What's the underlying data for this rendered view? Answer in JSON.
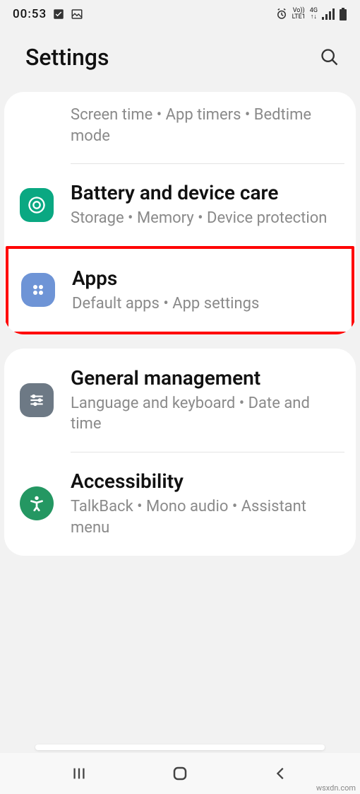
{
  "status": {
    "time": "00:53",
    "vo": "Vo))",
    "lte": "LTE1",
    "net": "4G"
  },
  "header": {
    "title": "Settings"
  },
  "groups": [
    {
      "items": [
        {
          "id": "digital-wellbeing",
          "title": "",
          "sub": "Screen time  •  App timers  •  Bedtime mode",
          "icon": null
        },
        {
          "id": "battery-device-care",
          "title": "Battery and device care",
          "sub": "Storage  •  Memory  •  Device protection",
          "icon": "care",
          "iconColor": "#0aa882"
        },
        {
          "id": "apps",
          "title": "Apps",
          "sub": "Default apps  •  App settings",
          "icon": "apps",
          "iconColor": "#6e94d6",
          "highlight": true
        }
      ]
    },
    {
      "items": [
        {
          "id": "general-management",
          "title": "General management",
          "sub": "Language and keyboard  •  Date and time",
          "icon": "sliders",
          "iconColor": "#6d7985"
        },
        {
          "id": "accessibility",
          "title": "Accessibility",
          "sub": "TalkBack  •  Mono audio  •  Assistant menu",
          "icon": "person",
          "iconColor": "#249762"
        }
      ]
    }
  ],
  "watermark": "wsxdn.com"
}
